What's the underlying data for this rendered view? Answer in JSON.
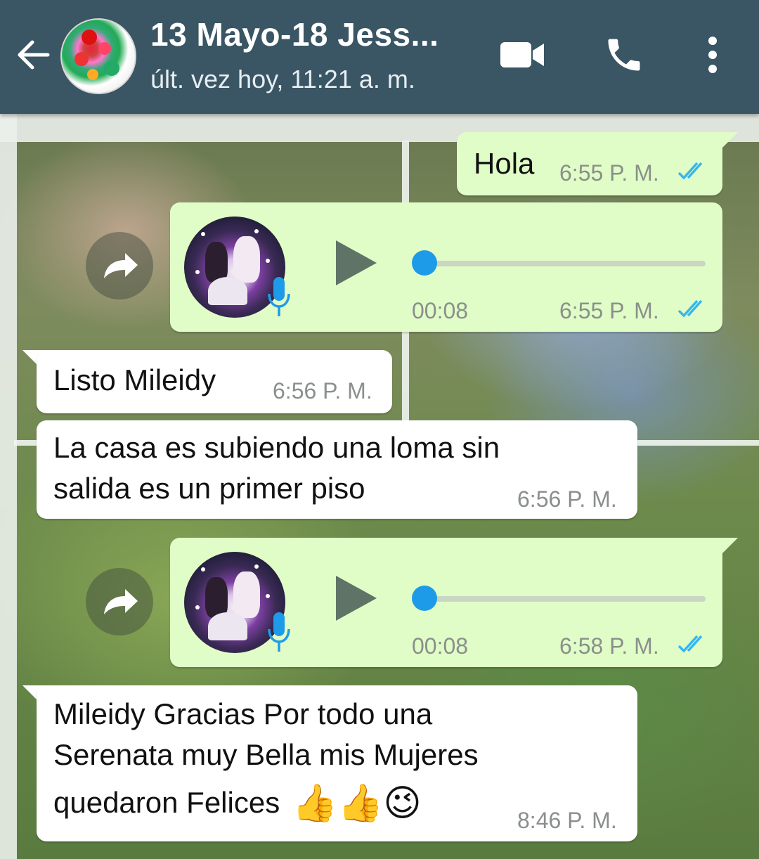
{
  "header": {
    "back_icon": "arrow-left-icon",
    "contact_name": "13 Mayo-18 Jess...",
    "status": "últ. vez hoy, 11:21 a. m.",
    "actions": [
      {
        "icon": "video-call-icon"
      },
      {
        "icon": "phone-call-icon"
      },
      {
        "icon": "more-vert-icon"
      }
    ],
    "bar_color": "#3a5564"
  },
  "messages": [
    {
      "type": "text",
      "direction": "out",
      "text": "Hola",
      "time": "6:55 P. M.",
      "status": "read"
    },
    {
      "type": "voice",
      "direction": "out",
      "duration": "00:08",
      "time": "6:55 P. M.",
      "status": "read",
      "progress": 0
    },
    {
      "type": "text",
      "direction": "in",
      "text": "Listo Mileidy",
      "time": "6:56 P. M."
    },
    {
      "type": "text",
      "direction": "in",
      "lines": [
        "La casa es subiendo una loma sin",
        "salida es un primer piso"
      ],
      "time": "6:56 P. M."
    },
    {
      "type": "voice",
      "direction": "out",
      "duration": "00:08",
      "time": "6:58 P. M.",
      "status": "read",
      "progress": 0
    },
    {
      "type": "text",
      "direction": "in",
      "lines": [
        "Mileidy Gracias Por todo una",
        "Serenata muy Bella mis Mujeres",
        "quedaron Felices"
      ],
      "emoji": "👍👍😉",
      "time": "8:46 P. M."
    }
  ],
  "colors": {
    "outgoing_bubble": "#e1fdc7",
    "incoming_bubble": "#ffffff",
    "read_ticks": "#34b7f1",
    "seek_knob": "#1e9be8"
  }
}
